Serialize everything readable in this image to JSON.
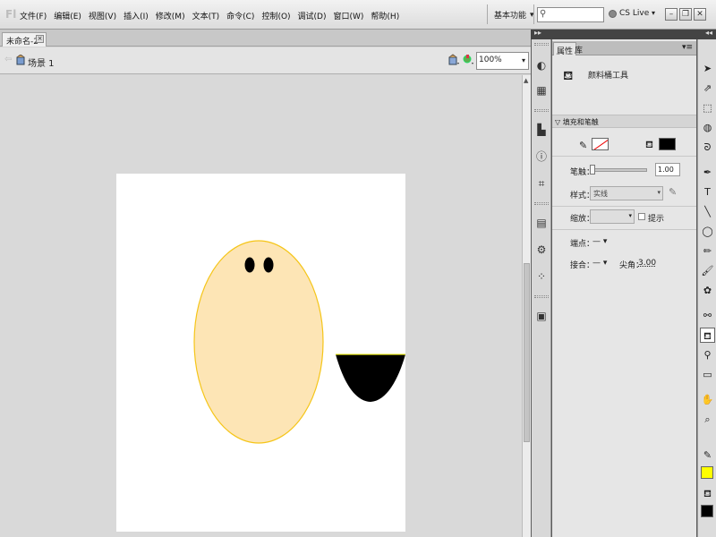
{
  "app": {
    "logo": "Fl"
  },
  "menu": [
    "文件(F)",
    "编辑(E)",
    "视图(V)",
    "插入(I)",
    "修改(M)",
    "文本(T)",
    "命令(C)",
    "控制(O)",
    "调试(D)",
    "窗口(W)",
    "帮助(H)"
  ],
  "titlebar": {
    "workspace_label": "基本功能",
    "search_placeholder": "",
    "cslive_label": "CS Live",
    "minimize": "–",
    "restore": "❐",
    "close": "✕"
  },
  "document": {
    "tab_title": "未命名-2*",
    "scene_label": "场景 1",
    "zoom": "100%"
  },
  "panel": {
    "tabs": [
      "属性",
      "库"
    ],
    "tool_name": "颜料桶工具",
    "section_title": "填充和笔触",
    "stroke_label": "笔触：",
    "stroke_value": "1.00",
    "style_label": "样式：",
    "style_value": "实线",
    "scale_label": "缩放：",
    "hint_label": "提示",
    "cap_label": "端点：",
    "cap_value": "— ▾",
    "join_label": "接合：",
    "join_value": "— ▾",
    "miter_label": "尖角：",
    "miter_value": "3.00"
  },
  "tools": [
    "selection-arrow",
    "subselection",
    "free-transform",
    "3d-rotation",
    "lasso",
    "pen",
    "text",
    "line",
    "oval",
    "pencil",
    "brush",
    "deco",
    "bone",
    "paint-bucket",
    "eyedropper",
    "eraser",
    "hand",
    "zoom"
  ],
  "colors": {
    "stroke": "#ffff00",
    "fill": "#000000",
    "stage": "#ffffff",
    "face_fill": "#fde5b5",
    "face_stroke": "#f5c518"
  }
}
